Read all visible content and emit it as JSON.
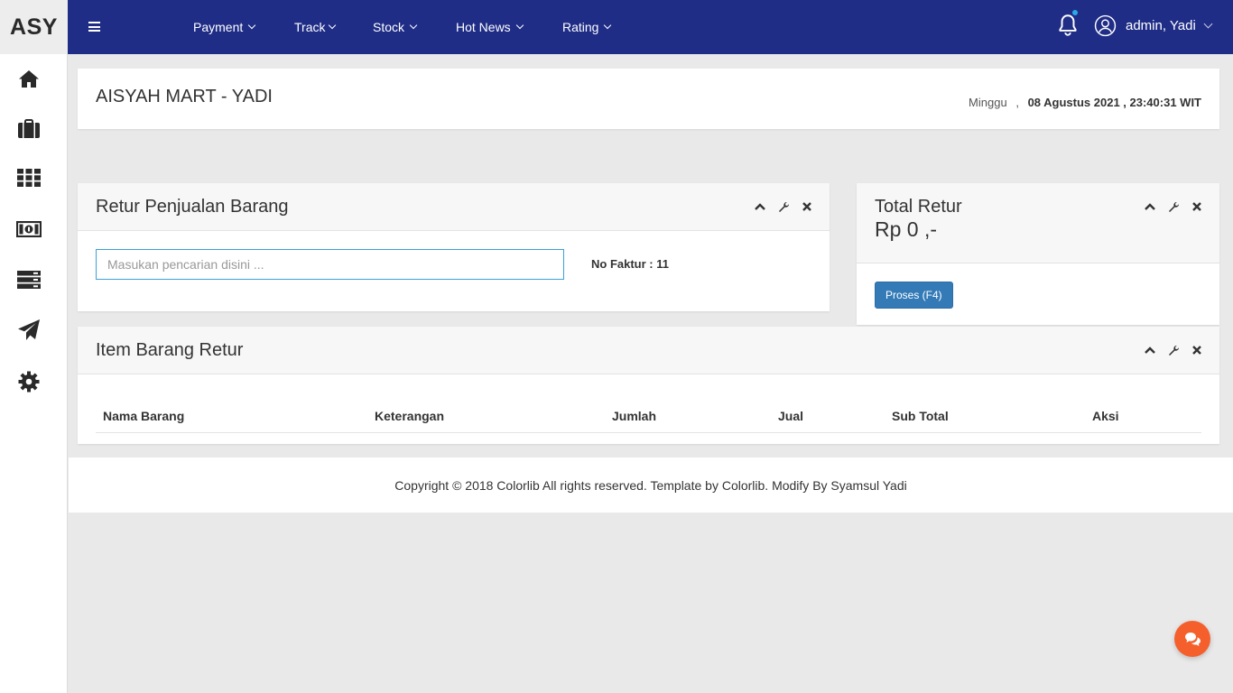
{
  "brand": "ASY",
  "nav": {
    "menus": [
      {
        "label": "Payment"
      },
      {
        "label": "Track"
      },
      {
        "label": "Stock"
      },
      {
        "label": "Hot News"
      },
      {
        "label": "Rating"
      }
    ],
    "user_label": "admin, Yadi"
  },
  "sidebar": {
    "icons": [
      "home-icon",
      "briefcase-icon",
      "grid-icon",
      "money-icon",
      "server-icon",
      "paper-plane-icon",
      "gear-icon"
    ]
  },
  "header": {
    "store_name": "AISYAH MART - YADI",
    "day": "Minggu",
    "separator": ",",
    "date_time": "08 Agustus 2021 , 23:40:31 WIT"
  },
  "retur_panel": {
    "title": "Retur Penjualan Barang",
    "search_placeholder": "Masukan pencarian disini ...",
    "faktur_label": "No Faktur : 11"
  },
  "total_panel": {
    "title": "Total Retur",
    "amount": "Rp 0 ,-",
    "button_label": "Proses (F4)"
  },
  "items_panel": {
    "title": "Item Barang Retur",
    "columns": [
      "Nama Barang",
      "Keterangan",
      "Jumlah",
      "Jual",
      "Sub Total",
      "Aksi"
    ],
    "rows": []
  },
  "footer": {
    "text": "Copyright © 2018 Colorlib All rights reserved. Template by Colorlib. Modify By Syamsul Yadi"
  },
  "colors": {
    "navbar": "#1f2d86",
    "primary_button": "#337ab7",
    "chat_button": "#f55f2c",
    "notification_dot": "#29a9e9"
  }
}
